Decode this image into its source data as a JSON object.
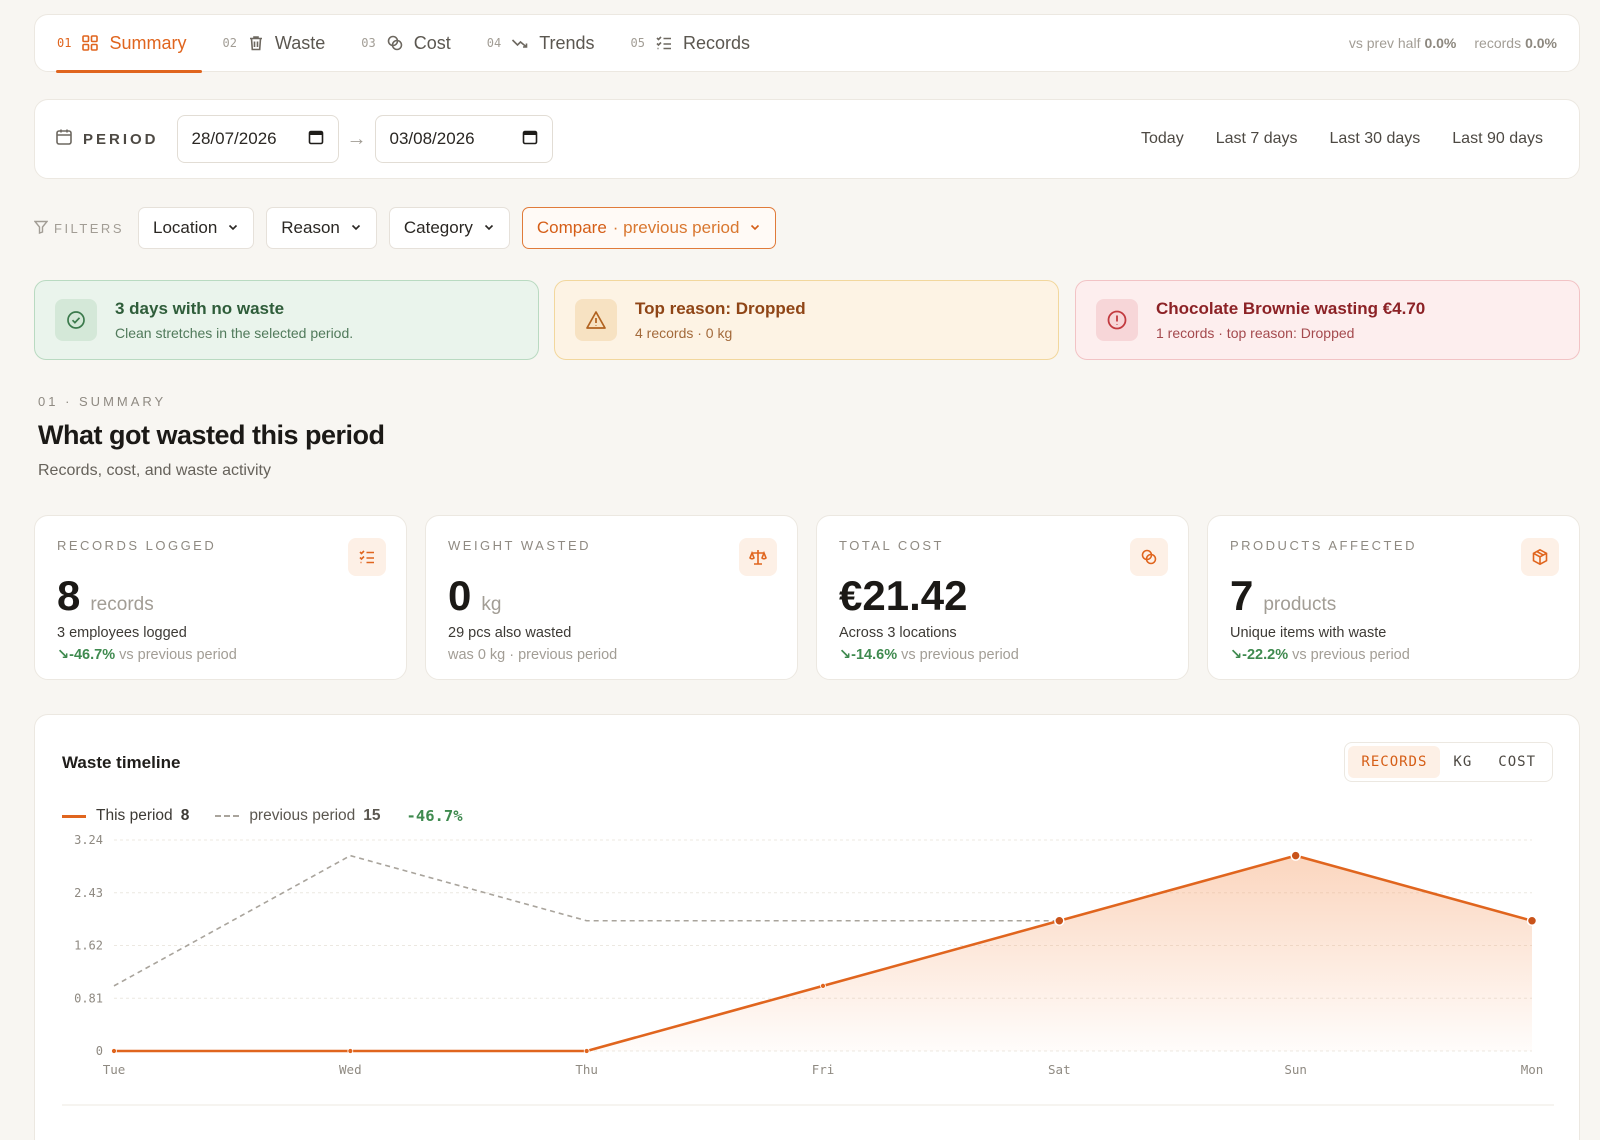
{
  "tabs": [
    {
      "num": "01",
      "label": "Summary",
      "icon": "grid-icon",
      "active": true
    },
    {
      "num": "02",
      "label": "Waste",
      "icon": "trash-icon"
    },
    {
      "num": "03",
      "label": "Cost",
      "icon": "coins-icon"
    },
    {
      "num": "04",
      "label": "Trends",
      "icon": "trend-down-icon"
    },
    {
      "num": "05",
      "label": "Records",
      "icon": "checklist-icon"
    }
  ],
  "header_stats": {
    "prev_half_label": "vs prev half",
    "prev_half_value": "0.0%",
    "records_label": "records",
    "records_value": "0.0%"
  },
  "period": {
    "label": "PERIOD",
    "start": "28/07/2026",
    "end": "03/08/2026",
    "presets": [
      "Today",
      "Last 7 days",
      "Last 30 days",
      "Last 90 days"
    ]
  },
  "filters": {
    "label": "FILTERS",
    "location": "Location",
    "reason": "Reason",
    "category": "Category",
    "compare": "Compare",
    "compare_sub": "· previous period"
  },
  "alerts": [
    {
      "title": "3 days with no waste",
      "sub": "Clean stretches in the selected period.",
      "tone": "#3b7a4c"
    },
    {
      "title": "Top reason: Dropped",
      "sub": "4 records · 0 kg",
      "tone": "#b1621f"
    },
    {
      "title": "Chocolate Brownie wasting €4.70",
      "sub": "1 records · top reason: Dropped",
      "tone": "#c23a3f"
    }
  ],
  "summary": {
    "eyebrow": "01 · SUMMARY",
    "title": "What got wasted this period",
    "subtitle": "Records, cost, and waste activity"
  },
  "metrics": [
    {
      "label": "RECORDS LOGGED",
      "value": "8",
      "unit": "records",
      "line1": "3 employees logged",
      "delta": "↘-46.7%",
      "delta_rest": " vs previous period",
      "icon": "checklist-icon"
    },
    {
      "label": "WEIGHT WASTED",
      "value": "0",
      "unit": "kg",
      "line1": "29 pcs also wasted",
      "delta": "",
      "delta_rest": "was 0 kg · previous period",
      "icon": "scale-icon"
    },
    {
      "label": "TOTAL COST",
      "value": "€21.42",
      "unit": "",
      "line1": "Across 3 locations",
      "delta": "↘-14.6%",
      "delta_rest": " vs previous period",
      "icon": "coins-icon"
    },
    {
      "label": "PRODUCTS AFFECTED",
      "value": "7",
      "unit": "products",
      "line1": "Unique items with waste",
      "delta": "↘-22.2%",
      "delta_rest": " vs previous period",
      "icon": "box-icon"
    }
  ],
  "timeline": {
    "title": "Waste timeline",
    "modes": [
      "RECORDS",
      "KG",
      "COST"
    ],
    "active_mode": "RECORDS",
    "legend": {
      "this_label": "This period",
      "this_total": "8",
      "prev_label": "previous period",
      "prev_total": "15",
      "change": "-46.7%"
    }
  },
  "chart_data": {
    "type": "line",
    "title": "Waste timeline",
    "categories": [
      "Tue",
      "Wed",
      "Thu",
      "Fri",
      "Sat",
      "Sun",
      "Mon"
    ],
    "series": [
      {
        "name": "This period",
        "values": [
          0,
          0,
          0,
          1,
          2,
          3,
          2
        ],
        "color": "#e0651e",
        "style": "solid-area"
      },
      {
        "name": "previous period",
        "values": [
          1,
          3,
          2,
          2,
          2,
          null,
          null
        ],
        "color": "#a9a49c",
        "style": "dashed"
      }
    ],
    "yticks": [
      "0",
      "0.81",
      "1.62",
      "2.43",
      "3.24"
    ],
    "ylim": [
      0,
      3.24
    ],
    "grid": true,
    "legend": "top-left"
  }
}
